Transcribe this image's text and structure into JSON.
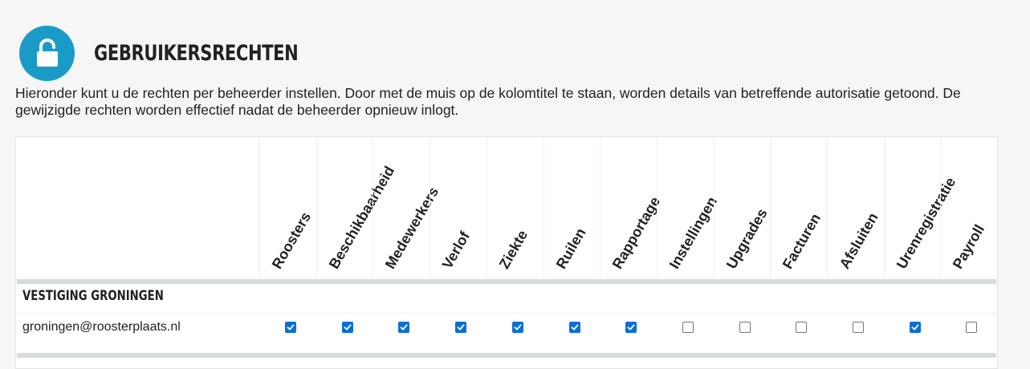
{
  "page": {
    "title": "GEBRUIKERSRECHTEN",
    "icon": "unlock-icon",
    "accent_color": "#1a9bc7",
    "intro": "Hieronder kunt u de rechten per beheerder instellen. Door met de muis op de kolomtitel te staan, worden details van betreffende autorisatie getoond. De gewijzigde rechten worden effectief nadat de beheerder opnieuw inlogt."
  },
  "columns": [
    "Roosters",
    "Beschikbaarheid",
    "Medewerkers",
    "Verlof",
    "Ziekte",
    "Ruilen",
    "Rapportage",
    "Instellingen",
    "Upgrades",
    "Facturen",
    "Afsluiten",
    "Urenregistratie",
    "Payroll"
  ],
  "group": {
    "title": "VESTIGING GRONINGEN",
    "users": [
      {
        "email": "groningen@roosterplaats.nl",
        "rights": [
          true,
          true,
          true,
          true,
          true,
          true,
          true,
          false,
          false,
          false,
          false,
          true,
          false
        ]
      }
    ]
  }
}
